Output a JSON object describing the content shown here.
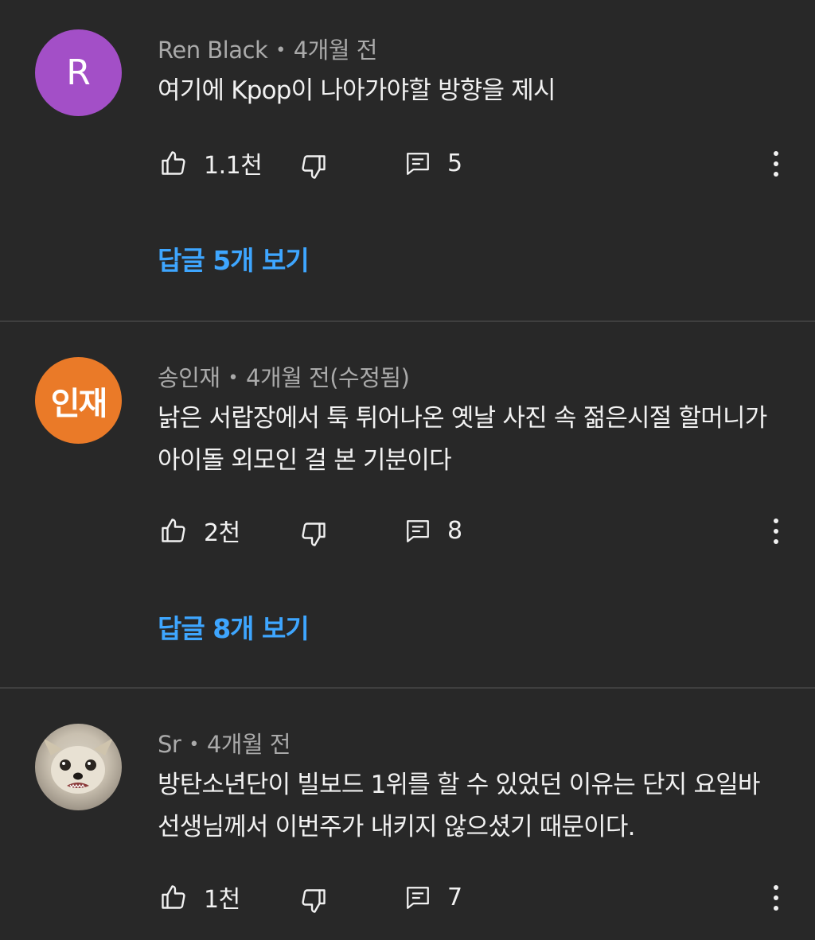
{
  "colors": {
    "background": "#282828",
    "divider": "#3f3f3f",
    "link": "#3ea6ff",
    "meta_text": "#aaaaaa",
    "primary_text": "#f1f1f1"
  },
  "meta_separator": "•",
  "comments": [
    {
      "avatar_text": "R",
      "avatar_color": "#a34fc7",
      "author": "Ren Black",
      "time": "4개월 전",
      "text": "여기에 Kpop이 나아가야할 방향을 제시",
      "likes": "1.1천",
      "replies_count": "5",
      "replies_link": "답글 5개 보기"
    },
    {
      "avatar_text": "인재",
      "avatar_color": "#ea7a28",
      "author": "송인재",
      "time": "4개월 전(수정됨)",
      "text": "낡은 서랍장에서 툭 튀어나온 옛날 사진 속 젊은시절 할머니가 아이돌 외모인 걸 본 기분이다",
      "likes": "2천",
      "replies_count": "8",
      "replies_link": "답글 8개 보기"
    },
    {
      "avatar_text": "",
      "avatar_color": "#c9c0b0",
      "author": "Sr",
      "time": "4개월 전",
      "text": "방탄소년단이 빌보드 1위를 할 수 있었던 이유는 단지 요일바 선생님께서 이번주가 내키지 않으셨기 때문이다.",
      "likes": "1천",
      "replies_count": "7"
    }
  ]
}
